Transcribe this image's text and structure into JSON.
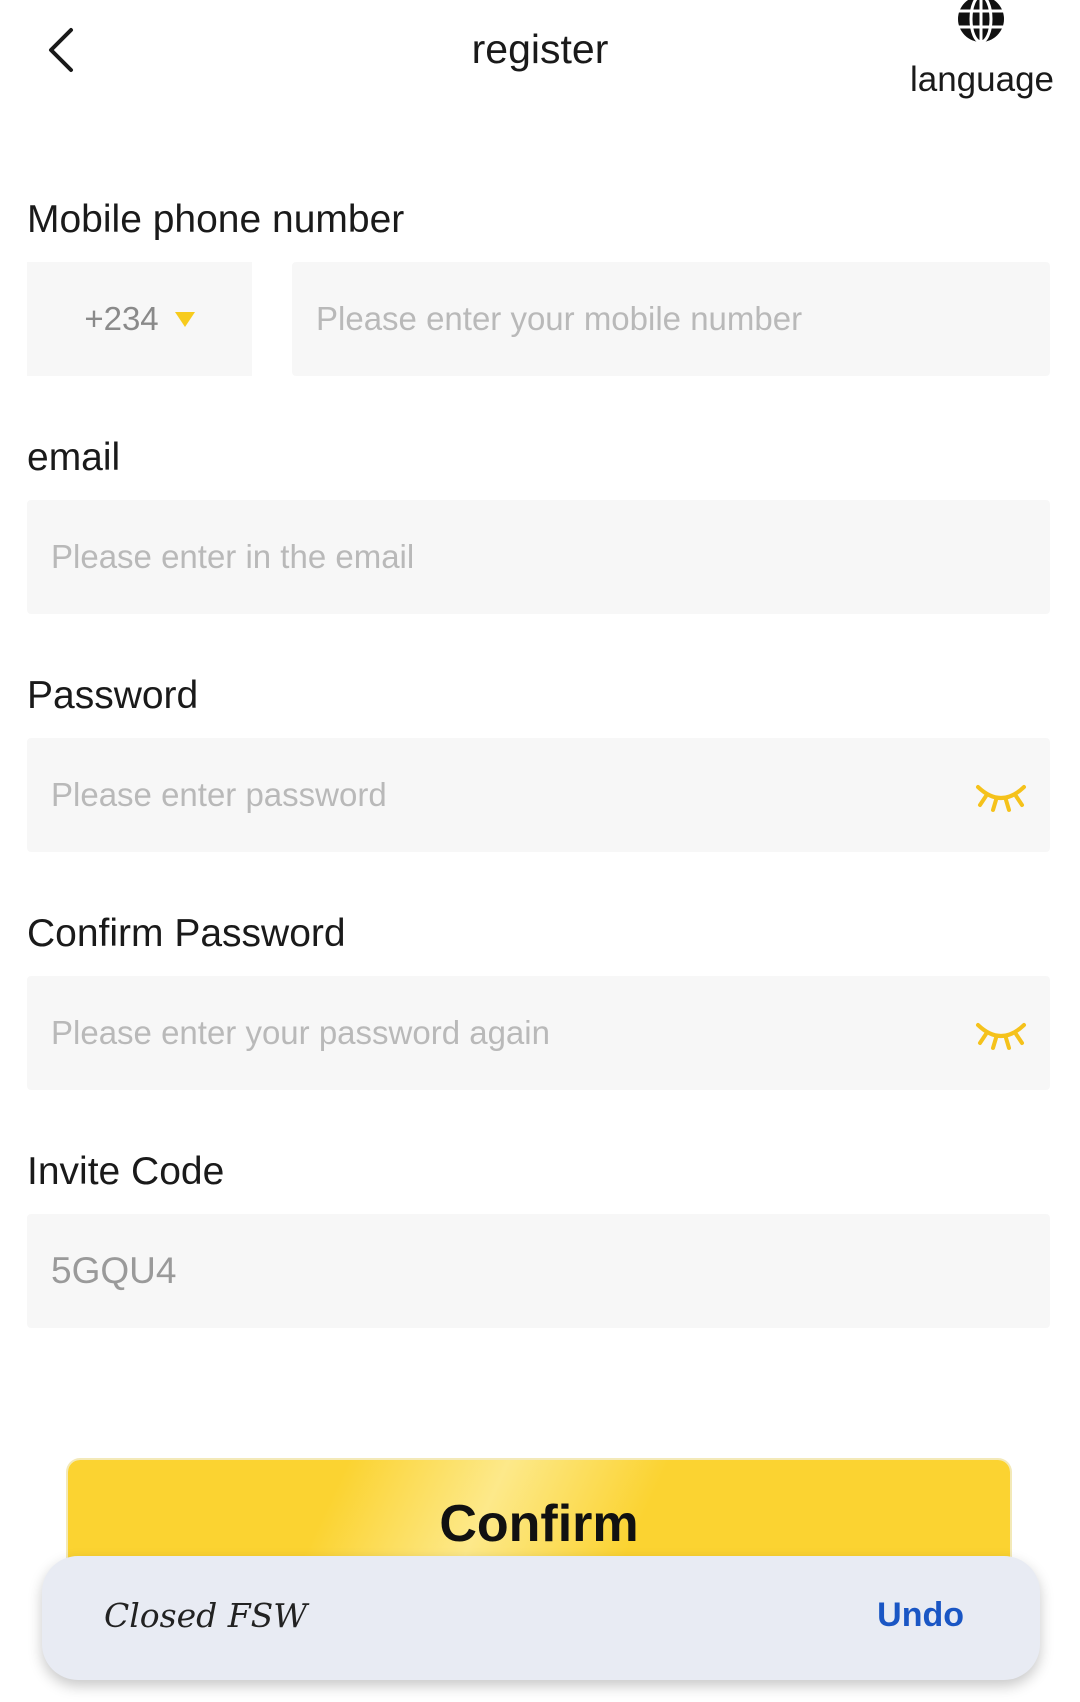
{
  "header": {
    "title": "register",
    "language_label": "language"
  },
  "form": {
    "phone": {
      "label": "Mobile phone number",
      "country_code": "+234",
      "placeholder": "Please enter your mobile number",
      "value": ""
    },
    "email": {
      "label": "email",
      "placeholder": "Please enter in the email",
      "value": ""
    },
    "password": {
      "label": "Password",
      "placeholder": "Please enter password",
      "value": ""
    },
    "confirm_password": {
      "label": "Confirm Password",
      "placeholder": "Please enter your password again",
      "value": ""
    },
    "invite_code": {
      "label": "Invite Code",
      "value": "5GQU4"
    }
  },
  "confirm_label": "Confirm",
  "toast": {
    "message": "Closed FSW",
    "action_label": "Undo"
  },
  "colors": {
    "accent_yellow": "#fbd331",
    "field_background": "#f7f7f7",
    "undo_blue": "#1a56c4"
  }
}
